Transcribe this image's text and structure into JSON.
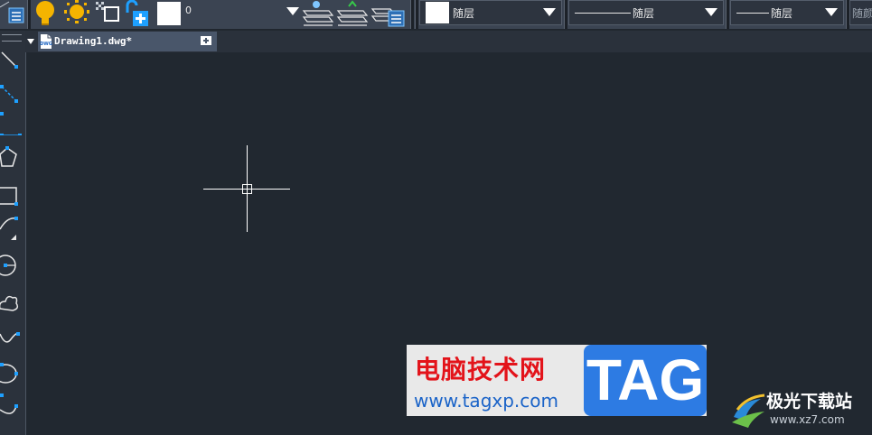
{
  "toolbar": {
    "layer_value": "0",
    "color_value": "随层",
    "linetype_value": "随层",
    "lineweight_value": "随层",
    "plotstyle_value": "随颜"
  },
  "tabs": [
    {
      "label": "Drawing1.dwg*",
      "badge": "DWG",
      "active": true
    }
  ],
  "watermark": {
    "cn_text": "电脑技术网",
    "url_text": "www.tagxp.com",
    "tag_text": "TAG"
  },
  "brand": {
    "name": "极光下载站",
    "url": "www.xz7.com"
  },
  "colors": {
    "canvas": "#212830",
    "toolbar": "#3b4452",
    "bulb": "#f5b400",
    "accent_blue": "#1ea0ff",
    "watermark_red": "#e3131a",
    "tag_blue": "#2d7be3"
  }
}
